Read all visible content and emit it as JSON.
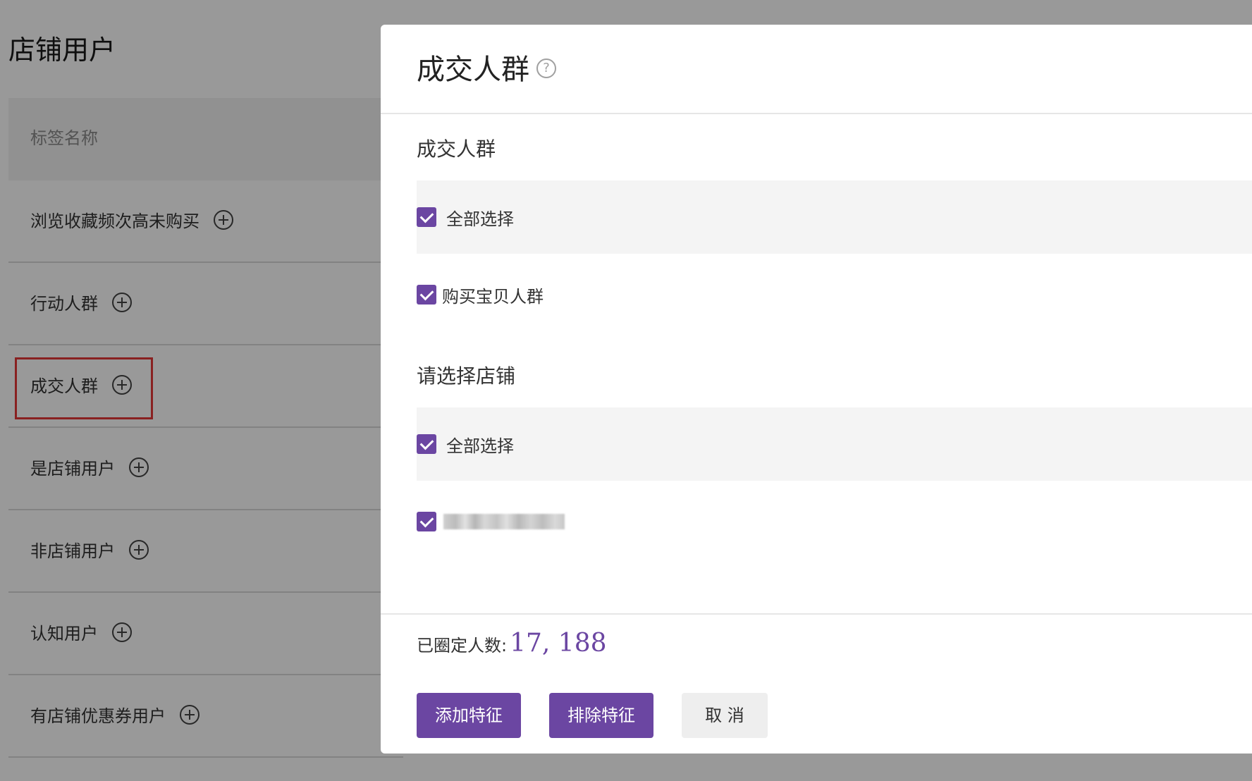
{
  "page": {
    "title": "店铺用户",
    "tag_header": "标签名称",
    "tags": [
      "浏览收藏频次高未购买",
      "行动人群",
      "成交人群",
      "是店铺用户",
      "非店铺用户",
      "认知用户",
      "有店铺优惠券用户"
    ],
    "highlighted_tag_index": 2
  },
  "modal": {
    "title": "成交人群",
    "help_icon": "?",
    "section1": {
      "title": "成交人群",
      "select_all_label": "全部选择",
      "select_all_checked": true,
      "options": [
        {
          "label": "购买宝贝人群",
          "checked": true
        }
      ]
    },
    "section2": {
      "title": "请选择店铺",
      "select_all_label": "全部选择",
      "select_all_checked": true,
      "options": [
        {
          "label": "",
          "checked": true,
          "blurred": true
        }
      ]
    },
    "count_label": "已圈定人数:",
    "count_value": "17, 188",
    "buttons": {
      "add": "添加特征",
      "exclude": "排除特征",
      "cancel": "取 消"
    }
  },
  "colors": {
    "accent": "#6b46a2",
    "highlight_border": "#e43838",
    "mask": "rgba(0,0,0,0.40)"
  }
}
